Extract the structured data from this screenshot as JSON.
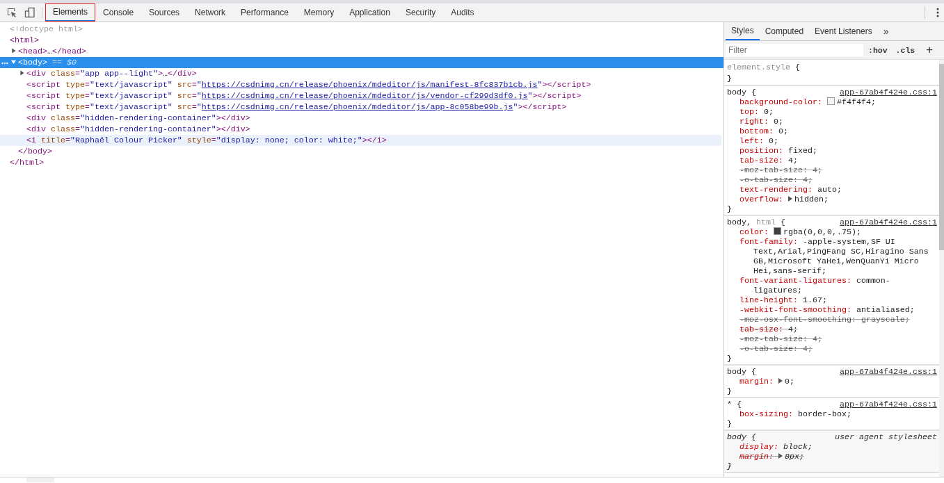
{
  "toolbar": {
    "tabs": [
      {
        "label": "Elements",
        "selected": true,
        "outlined": true
      },
      {
        "label": "Console",
        "selected": false,
        "outlined": false
      },
      {
        "label": "Sources",
        "selected": false,
        "outlined": false
      },
      {
        "label": "Network",
        "selected": false,
        "outlined": false
      },
      {
        "label": "Performance",
        "selected": false,
        "outlined": false
      },
      {
        "label": "Memory",
        "selected": false,
        "outlined": false
      },
      {
        "label": "Application",
        "selected": false,
        "outlined": false
      },
      {
        "label": "Security",
        "selected": false,
        "outlined": false
      },
      {
        "label": "Audits",
        "selected": false,
        "outlined": false
      }
    ]
  },
  "elements": {
    "nodes": [
      {
        "open": [
          {
            "kind": "comment",
            "text": "<!doctype html>"
          }
        ],
        "selected": false,
        "hovered": false
      },
      {
        "open": [
          {
            "kind": "tag",
            "text": "<html>"
          }
        ],
        "close": [
          {
            "kind": "tag",
            "text": "</html>"
          }
        ],
        "selected": false,
        "hovered": false,
        "children": [
          {
            "open": [
              {
                "kind": "tag",
                "text": "<head>"
              },
              {
                "kind": "text",
                "text": "…"
              },
              {
                "kind": "tag",
                "text": "</head>"
              }
            ],
            "expanded": false,
            "selected": false,
            "hovered": false
          },
          {
            "open": [
              {
                "kind": "tag",
                "text": "<body>"
              },
              {
                "kind": "marker",
                "text": " == $0"
              }
            ],
            "close": [
              {
                "kind": "tag",
                "text": "</body>"
              }
            ],
            "expanded": true,
            "selected": true,
            "hovered": false,
            "children": [
              {
                "open": [
                  {
                    "kind": "tag",
                    "text": "<div"
                  },
                  {
                    "kind": "attr",
                    "text": " class"
                  },
                  {
                    "kind": "tag",
                    "text": "="
                  },
                  {
                    "kind": "value",
                    "text": "\"app app--light\""
                  },
                  {
                    "kind": "tag",
                    "text": ">"
                  },
                  {
                    "kind": "text",
                    "text": "…"
                  },
                  {
                    "kind": "tag",
                    "text": "</div>"
                  }
                ],
                "expanded": false,
                "selected": false,
                "hovered": false
              },
              {
                "open": [
                  {
                    "kind": "tag",
                    "text": "<script"
                  },
                  {
                    "kind": "attr",
                    "text": " type"
                  },
                  {
                    "kind": "tag",
                    "text": "="
                  },
                  {
                    "kind": "value",
                    "text": "\"text/javascript\""
                  },
                  {
                    "kind": "attr",
                    "text": " src"
                  },
                  {
                    "kind": "tag",
                    "text": "="
                  },
                  {
                    "kind": "value",
                    "text": "\""
                  },
                  {
                    "kind": "link",
                    "text": "https://csdnimg.cn/release/phoenix/mdeditor/js/manifest-8fc837b1cb.js"
                  },
                  {
                    "kind": "value",
                    "text": "\""
                  },
                  {
                    "kind": "tag",
                    "text": "></script>"
                  }
                ],
                "selected": false,
                "hovered": false
              },
              {
                "open": [
                  {
                    "kind": "tag",
                    "text": "<script"
                  },
                  {
                    "kind": "attr",
                    "text": " type"
                  },
                  {
                    "kind": "tag",
                    "text": "="
                  },
                  {
                    "kind": "value",
                    "text": "\"text/javascript\""
                  },
                  {
                    "kind": "attr",
                    "text": " src"
                  },
                  {
                    "kind": "tag",
                    "text": "="
                  },
                  {
                    "kind": "value",
                    "text": "\""
                  },
                  {
                    "kind": "link",
                    "text": "https://csdnimg.cn/release/phoenix/mdeditor/js/vendor-cf299d3df0.js"
                  },
                  {
                    "kind": "value",
                    "text": "\""
                  },
                  {
                    "kind": "tag",
                    "text": "></script>"
                  }
                ],
                "selected": false,
                "hovered": false
              },
              {
                "open": [
                  {
                    "kind": "tag",
                    "text": "<script"
                  },
                  {
                    "kind": "attr",
                    "text": " type"
                  },
                  {
                    "kind": "tag",
                    "text": "="
                  },
                  {
                    "kind": "value",
                    "text": "\"text/javascript\""
                  },
                  {
                    "kind": "attr",
                    "text": " src"
                  },
                  {
                    "kind": "tag",
                    "text": "="
                  },
                  {
                    "kind": "value",
                    "text": "\""
                  },
                  {
                    "kind": "link",
                    "text": "https://csdnimg.cn/release/phoenix/mdeditor/js/app-8c058be99b.js"
                  },
                  {
                    "kind": "value",
                    "text": "\""
                  },
                  {
                    "kind": "tag",
                    "text": "></script>"
                  }
                ],
                "selected": false,
                "hovered": false
              },
              {
                "open": [
                  {
                    "kind": "tag",
                    "text": "<div"
                  },
                  {
                    "kind": "attr",
                    "text": " class"
                  },
                  {
                    "kind": "tag",
                    "text": "="
                  },
                  {
                    "kind": "value",
                    "text": "\"hidden-rendering-container\""
                  },
                  {
                    "kind": "tag",
                    "text": "></div>"
                  }
                ],
                "selected": false,
                "hovered": false
              },
              {
                "open": [
                  {
                    "kind": "tag",
                    "text": "<div"
                  },
                  {
                    "kind": "attr",
                    "text": " class"
                  },
                  {
                    "kind": "tag",
                    "text": "="
                  },
                  {
                    "kind": "value",
                    "text": "\"hidden-rendering-container\""
                  },
                  {
                    "kind": "tag",
                    "text": "></div>"
                  }
                ],
                "selected": false,
                "hovered": false
              },
              {
                "open": [
                  {
                    "kind": "tag",
                    "text": "<i"
                  },
                  {
                    "kind": "attr",
                    "text": " title"
                  },
                  {
                    "kind": "tag",
                    "text": "="
                  },
                  {
                    "kind": "value",
                    "text": "\"Raphaël Colour Picker\""
                  },
                  {
                    "kind": "attr",
                    "text": " style"
                  },
                  {
                    "kind": "tag",
                    "text": "="
                  },
                  {
                    "kind": "value",
                    "text": "\"display: none; color: white;\""
                  },
                  {
                    "kind": "tag",
                    "text": "></i>"
                  }
                ],
                "selected": false,
                "hovered": true
              }
            ]
          }
        ]
      }
    ]
  },
  "styles_pane": {
    "tabs": [
      {
        "label": "Styles",
        "selected": true
      },
      {
        "label": "Computed",
        "selected": false
      },
      {
        "label": "Event Listeners",
        "selected": false
      }
    ],
    "more": "»",
    "filter": {
      "placeholder": "Filter"
    },
    "hov": ":hov",
    "cls": ".cls",
    "add": "+",
    "rules": [
      {
        "kind": "inline",
        "selector": [
          {
            "text": "element.style",
            "matched": true
          }
        ],
        "open": "{",
        "close": "}"
      },
      {
        "kind": "author",
        "selector": [
          {
            "text": "body",
            "matched": true
          }
        ],
        "open": "{",
        "close": "}",
        "source": "app-67ab4f424e.css:1",
        "declarations": [
          {
            "name": "background-color:",
            "value": "#f4f4f4;",
            "color": "#f4f4f4",
            "overridden": false,
            "invalid": false
          },
          {
            "name": "top:",
            "value": "0;",
            "overridden": false,
            "invalid": false
          },
          {
            "name": "right:",
            "value": "0;",
            "overridden": false,
            "invalid": false
          },
          {
            "name": "bottom:",
            "value": "0;",
            "overridden": false,
            "invalid": false
          },
          {
            "name": "left:",
            "value": "0;",
            "overridden": false,
            "invalid": false
          },
          {
            "name": "position:",
            "value": "fixed;",
            "overridden": false,
            "invalid": false
          },
          {
            "name": "tab-size:",
            "value": "4;",
            "overridden": false,
            "invalid": false
          },
          {
            "name": "-moz-tab-size:",
            "value": "4;",
            "overridden": true,
            "invalid": true
          },
          {
            "name": "-o-tab-size:",
            "value": "4;",
            "overridden": true,
            "invalid": true
          },
          {
            "name": "text-rendering:",
            "value": "auto;",
            "overridden": false,
            "invalid": false
          },
          {
            "name": "overflow:",
            "value": "hidden;",
            "overridden": false,
            "invalid": false,
            "expandable": true
          }
        ]
      },
      {
        "kind": "author",
        "selector": [
          {
            "text": "body,",
            "matched": true
          },
          {
            "text": "html",
            "matched": false
          }
        ],
        "open": "{",
        "close": "}",
        "source": "app-67ab4f424e.css:1",
        "declarations": [
          {
            "name": "color:",
            "value": "rgba(0,0,0,.75);",
            "color": "#404040",
            "overridden": false,
            "invalid": false
          },
          {
            "name": "font-family:",
            "value": "-apple-system,SF UI Text,Arial,PingFang SC,Hiragino Sans GB,Microsoft YaHei,WenQuanYi Micro Hei,sans-serif;",
            "overridden": false,
            "invalid": false
          },
          {
            "name": "font-variant-ligatures:",
            "value": "common-ligatures;",
            "overridden": false,
            "invalid": false
          },
          {
            "name": "line-height:",
            "value": "1.67;",
            "overridden": false,
            "invalid": false
          },
          {
            "name": "-webkit-font-smoothing:",
            "value": "antialiased;",
            "overridden": false,
            "invalid": false
          },
          {
            "name": "-moz-osx-font-smoothing:",
            "value": "grayscale;",
            "overridden": true,
            "invalid": true
          },
          {
            "name": "tab-size:",
            "value": "4;",
            "overridden": true,
            "invalid": false
          },
          {
            "name": "-moz-tab-size:",
            "value": "4;",
            "overridden": true,
            "invalid": true
          },
          {
            "name": "-o-tab-size:",
            "value": "4;",
            "overridden": true,
            "invalid": true
          }
        ]
      },
      {
        "kind": "author",
        "selector": [
          {
            "text": "body",
            "matched": true
          }
        ],
        "open": "{",
        "close": "}",
        "source": "app-67ab4f424e.css:1",
        "declarations": [
          {
            "name": "margin:",
            "value": "0;",
            "overridden": false,
            "invalid": false,
            "expandable": true
          }
        ]
      },
      {
        "kind": "author",
        "selector": [
          {
            "text": "*",
            "matched": true
          }
        ],
        "open": "{",
        "close": "}",
        "source": "app-67ab4f424e.css:1",
        "declarations": [
          {
            "name": "box-sizing:",
            "value": "border-box;",
            "overridden": false,
            "invalid": false
          }
        ]
      },
      {
        "kind": "user-agent",
        "selector": [
          {
            "text": "body",
            "matched": true
          }
        ],
        "open": "{",
        "close": "}",
        "source": "user agent stylesheet",
        "declarations": [
          {
            "name": "display:",
            "value": "block;",
            "overridden": false,
            "invalid": false
          },
          {
            "name": "margin:",
            "value": "8px;",
            "overridden": true,
            "invalid": false,
            "expandable": true
          }
        ]
      }
    ]
  }
}
